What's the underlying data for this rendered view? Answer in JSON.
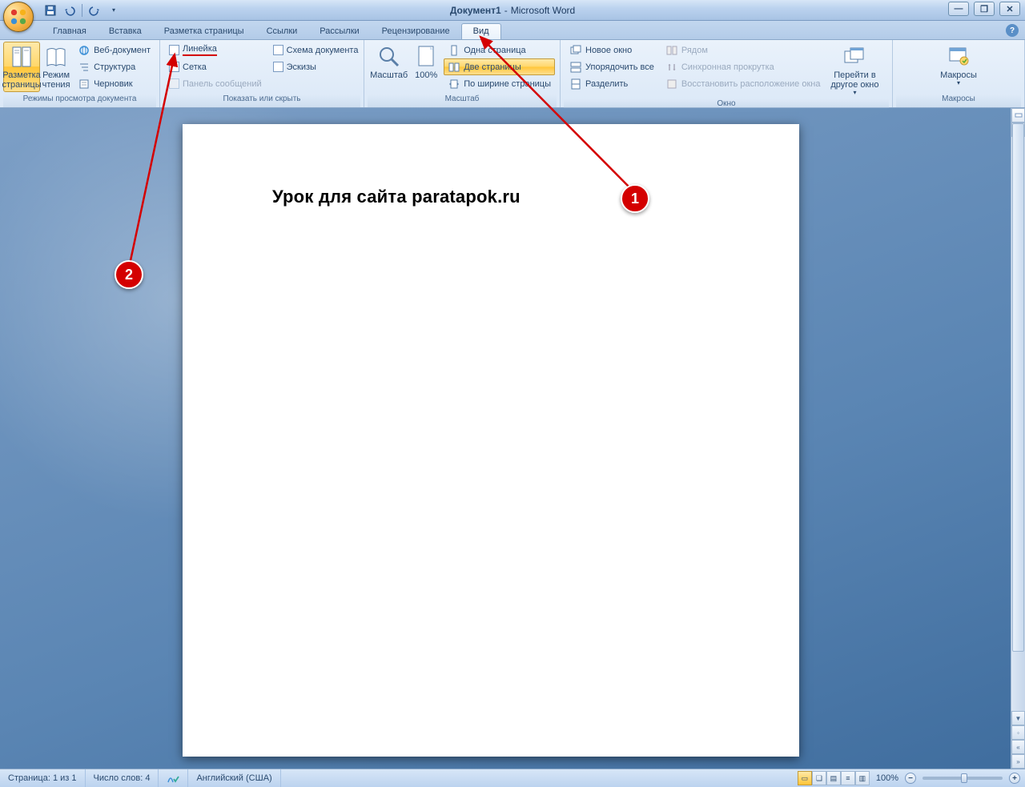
{
  "title": {
    "doc": "Документ1",
    "app": "Microsoft Word"
  },
  "tabs": {
    "home": "Главная",
    "insert": "Вставка",
    "page_layout": "Разметка страницы",
    "references": "Ссылки",
    "mailings": "Рассылки",
    "review": "Рецензирование",
    "view": "Вид"
  },
  "ribbon": {
    "views_group": {
      "label": "Режимы просмотра документа",
      "print_layout": "Разметка страницы",
      "full_reading": "Режим чтения",
      "web_layout": "Веб-документ",
      "outline": "Структура",
      "draft": "Черновик"
    },
    "show_hide_group": {
      "label": "Показать или скрыть",
      "ruler": "Линейка",
      "gridlines": "Сетка",
      "message_bar": "Панель сообщений",
      "document_map": "Схема документа",
      "thumbnails": "Эскизы"
    },
    "zoom_group": {
      "label": "Масштаб",
      "zoom": "Масштаб",
      "hundred": "100%",
      "one_page": "Одна страница",
      "two_pages": "Две страницы",
      "page_width": "По ширине страницы"
    },
    "window_group": {
      "label": "Окно",
      "new_window": "Новое окно",
      "arrange_all": "Упорядочить все",
      "split": "Разделить",
      "side_by_side": "Рядом",
      "sync_scroll": "Синхронная прокрутка",
      "reset_pos": "Восстановить расположение окна",
      "switch": "Перейти в другое окно"
    },
    "macros_group": {
      "label": "Макросы",
      "macros": "Макросы"
    }
  },
  "document": {
    "body_text": "Урок для сайта paratapok.ru"
  },
  "status": {
    "page": "Страница: 1 из 1",
    "words": "Число слов: 4",
    "language": "Английский (США)",
    "zoom": "100%"
  },
  "annotations": {
    "callout1": "1",
    "callout2": "2"
  }
}
